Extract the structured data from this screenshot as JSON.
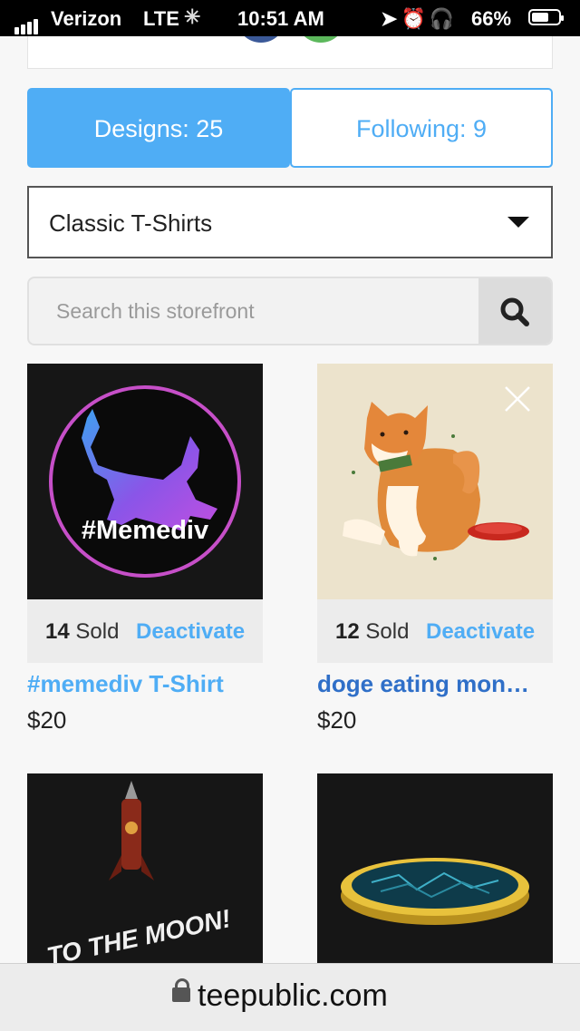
{
  "status_bar": {
    "carrier": "Verizon",
    "network": "LTE",
    "time": "10:51 AM",
    "battery_percent": "66%",
    "battery_level": 0.66
  },
  "tabs": [
    {
      "label": "Designs: 25",
      "active": true
    },
    {
      "label": "Following: 9",
      "active": false
    }
  ],
  "category_select": {
    "value": "Classic T-Shirts"
  },
  "search": {
    "placeholder": "Search this storefront",
    "value": ""
  },
  "products": [
    {
      "sold_count": "14",
      "sold_label": "Sold",
      "action": "Deactivate",
      "title": "#memediv T-Shirt",
      "price": "$20",
      "artwork_text": "#Memediv"
    },
    {
      "sold_count": "12",
      "sold_label": "Sold",
      "action": "Deactivate",
      "title": "doge eating mon…",
      "price": "$20"
    },
    {
      "artwork_text": "TO THE MOON!"
    },
    {}
  ],
  "url_bar": {
    "domain": "teepublic.com"
  },
  "colors": {
    "accent": "#4fadf5",
    "title_dark": "#2f6fc8",
    "background": "#f7f7f7"
  }
}
